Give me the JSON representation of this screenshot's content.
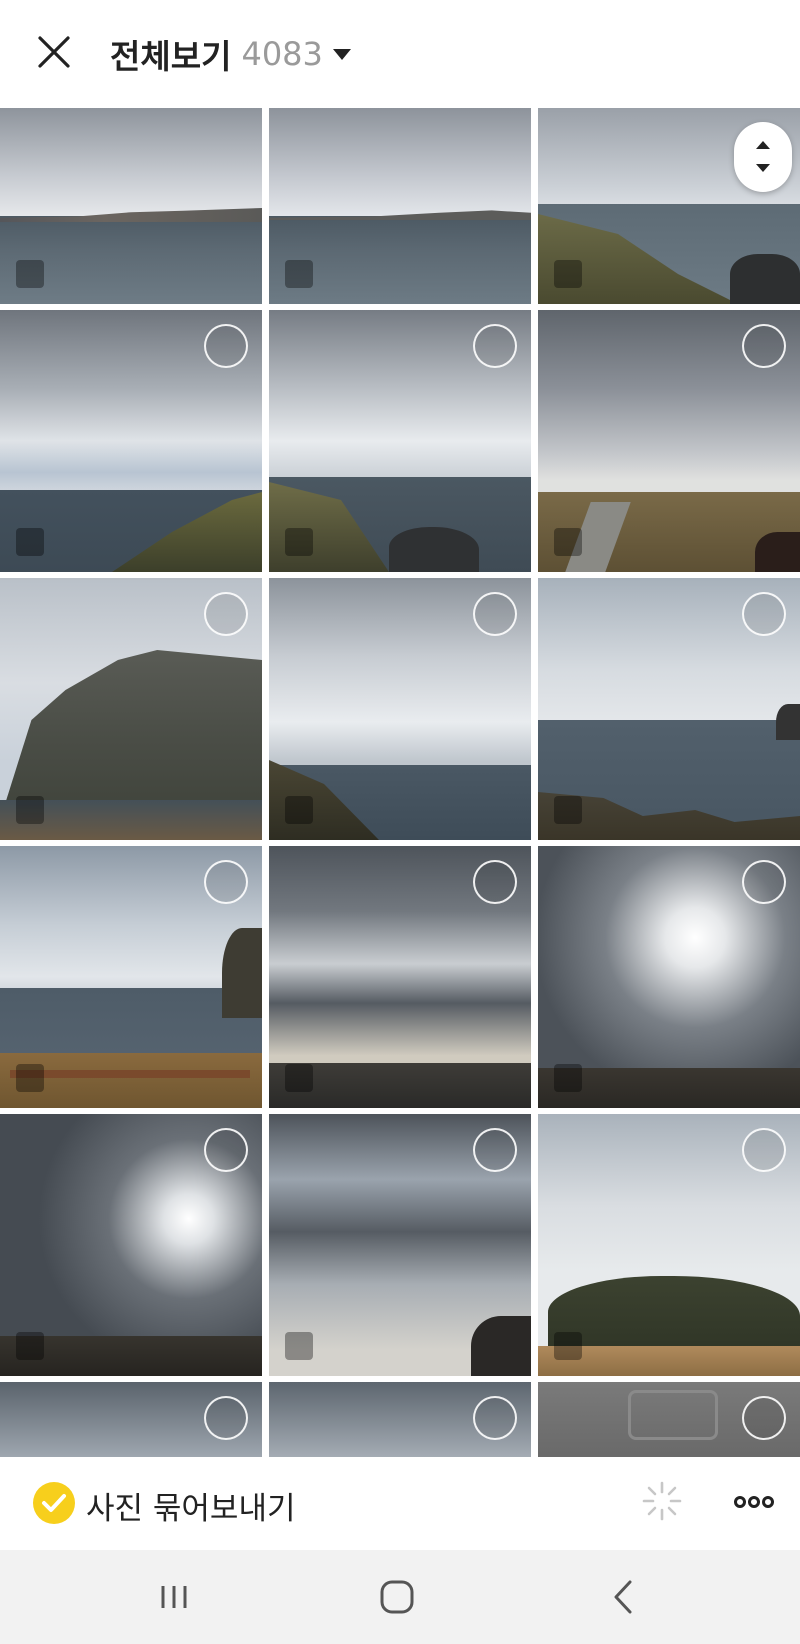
{
  "header": {
    "title": "전체보기",
    "count": "4083",
    "close_icon": "close-icon",
    "dropdown_icon": "caret-down-icon"
  },
  "grid": {
    "photos": [
      {
        "kind": "sea-horizon",
        "selectable": false
      },
      {
        "kind": "sea-horizon",
        "selectable": false
      },
      {
        "kind": "coast-village",
        "selectable": false
      },
      {
        "kind": "cloudy-sea-cliff",
        "selectable": true
      },
      {
        "kind": "coast-rocks",
        "selectable": true
      },
      {
        "kind": "trail-field",
        "selectable": true
      },
      {
        "kind": "cliff-mountain",
        "selectable": true
      },
      {
        "kind": "sea-clouds",
        "selectable": true
      },
      {
        "kind": "sea-rocks",
        "selectable": true
      },
      {
        "kind": "sea-fence",
        "selectable": true
      },
      {
        "kind": "dark-clouds-fence",
        "selectable": true
      },
      {
        "kind": "dark-clouds-sun",
        "selectable": true
      },
      {
        "kind": "dark-clouds-sun",
        "selectable": true
      },
      {
        "kind": "dark-clouds",
        "selectable": true
      },
      {
        "kind": "sunrise-peak",
        "selectable": true
      },
      {
        "kind": "bright-sky",
        "selectable": true
      },
      {
        "kind": "bright-sky",
        "selectable": true
      },
      {
        "kind": "car-interior",
        "selectable": true
      }
    ]
  },
  "bottom": {
    "bundle_label": "사진 묶어보내기",
    "bundle_checked": true,
    "check_color": "#f7cf1c"
  },
  "nav": {
    "recent_icon": "recent-apps-icon",
    "home_icon": "home-icon",
    "back_icon": "back-icon"
  }
}
